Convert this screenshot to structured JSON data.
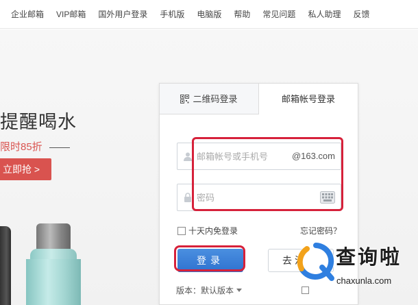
{
  "topnav": {
    "items": [
      {
        "label": "企业邮箱"
      },
      {
        "label": "VIP邮箱"
      },
      {
        "label": "国外用户登录"
      },
      {
        "label": "手机版"
      },
      {
        "label": "电脑版"
      },
      {
        "label": "帮助"
      },
      {
        "label": "常见问题"
      },
      {
        "label": "私人助理"
      },
      {
        "label": "反馈"
      }
    ]
  },
  "promo": {
    "title": "提醒喝水",
    "subtitle": "限时85折",
    "button_label": "立即抢 >"
  },
  "login": {
    "tabs": [
      {
        "label": "二维码登录",
        "icon": "qr-code-icon"
      },
      {
        "label": "邮箱帐号登录",
        "active": true
      }
    ],
    "account_placeholder": "邮箱帐号或手机号",
    "domain_suffix": "@163.com",
    "password_placeholder": "密码",
    "remember_label": "十天内免登录",
    "forgot_label": "忘记密码？",
    "login_button": "登录",
    "register_button": "去注册",
    "version_label": "版本：默认版本"
  },
  "watermark": {
    "text": "查询啦",
    "url": "chaxunla.com"
  },
  "colors": {
    "primary_button": "#2f72cf",
    "promo_red": "#d9534f",
    "annotation_red": "#d6213a"
  }
}
